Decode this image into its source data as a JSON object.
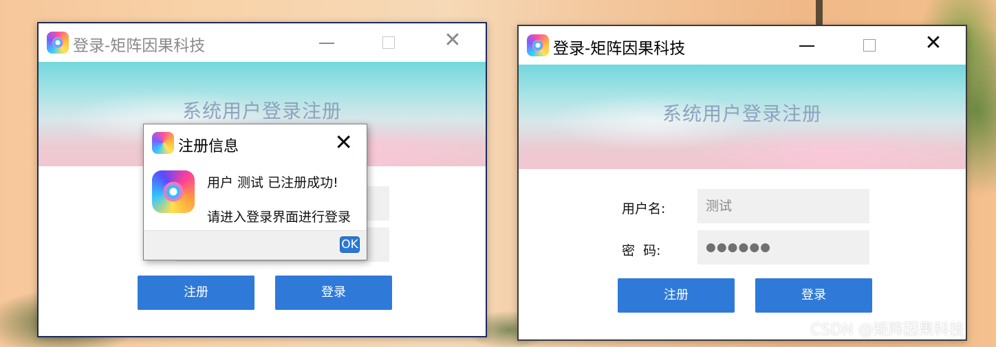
{
  "left_window": {
    "title": "登录-矩阵因果科技",
    "banner_title": "系统用户登录注册",
    "register_label": "注册",
    "login_label": "登录",
    "title_color": "#8a8a8a"
  },
  "right_window": {
    "title": "登录-矩阵因果科技",
    "banner_title": "系统用户登录注册",
    "username_label": "用户名:",
    "username_value": "测试",
    "password_label": "密  码:",
    "password_value": "●●●●●●",
    "register_label": "注册",
    "login_label": "登录",
    "title_color": "#000000"
  },
  "dialog": {
    "title": "注册信息",
    "message_line1": "用户 测试 已注册成功!",
    "message_line2": "请进入登录界面进行登录",
    "ok_label": "OK"
  },
  "watermark": "CSDN @矩阵因果科技",
  "colors": {
    "button_blue": "#2f7ad9",
    "banner_text": "#8fa2bd"
  },
  "icons": [
    "app-logo-icon",
    "minimize-icon",
    "maximize-icon",
    "close-icon"
  ]
}
